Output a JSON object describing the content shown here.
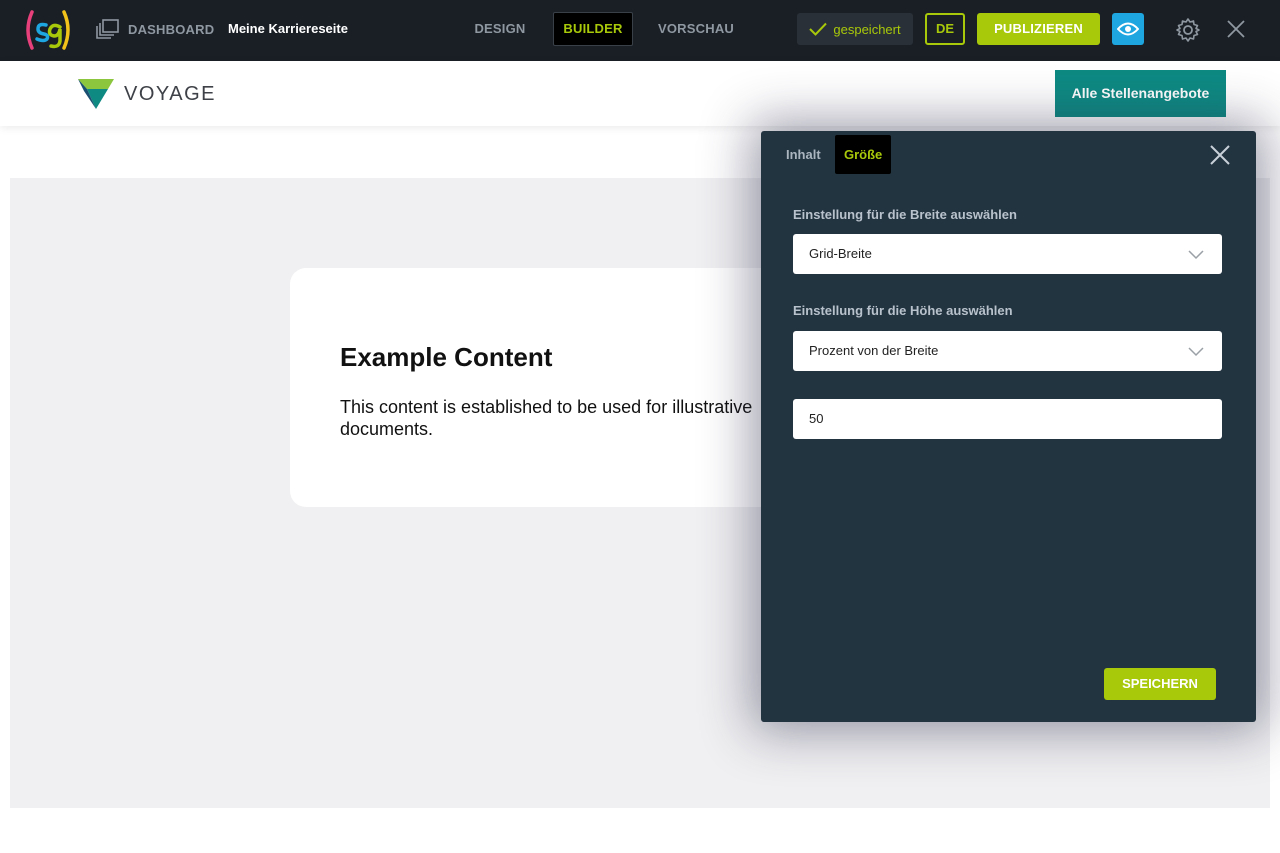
{
  "topbar": {
    "dashboard_label": "DASHBOARD",
    "page_name": "Meine Karriereseite",
    "tabs": [
      "DESIGN",
      "BUILDER",
      "VORSCHAU"
    ],
    "active_tab": "BUILDER",
    "saved_label": "gespeichert",
    "language": "DE",
    "publish_label": "PUBLIZIEREN"
  },
  "site": {
    "brand": "VOYAGE",
    "jobs_button": "Alle Stellenangebote"
  },
  "card": {
    "title": "Example Content",
    "body": "This content is established to be used for illustrative documents."
  },
  "panel": {
    "tabs": [
      "Inhalt",
      "Größe"
    ],
    "active_tab": "Größe",
    "width_label": "Einstellung für die Breite auswählen",
    "width_value": "Grid-Breite",
    "height_label": "Einstellung für die Höhe auswählen",
    "height_value": "Prozent von der Breite",
    "percent_value": "50",
    "save_label": "SPEICHERN"
  },
  "icons": [
    "sg-logo",
    "pages-icon",
    "check-icon",
    "eye-icon",
    "gear-icon",
    "close-icon",
    "voyage-logo",
    "chevron-down-icon"
  ],
  "colors": {
    "topbar": "#1a1f26",
    "accent_green": "#a8c80a",
    "preview_blue": "#1ea6e0",
    "teal": "#0e8a83",
    "panel": "#233441"
  }
}
